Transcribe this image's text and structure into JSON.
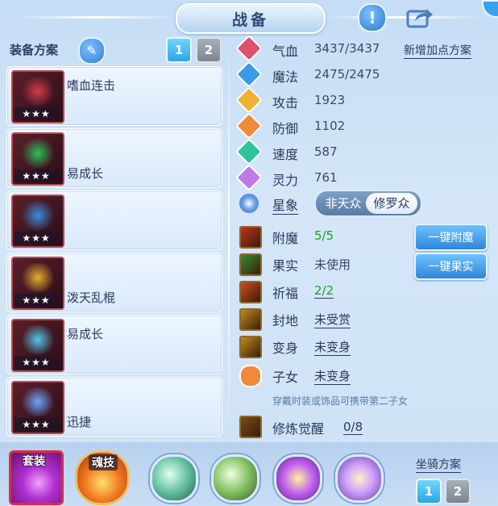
{
  "header": {
    "title": "战备",
    "info_icon": "info-icon",
    "share_icon": "share-icon"
  },
  "left": {
    "scheme_label": "装备方案",
    "scheme_tabs": [
      "1",
      "2"
    ],
    "active_scheme": "1",
    "skills": [
      {
        "name": "嗜血连击",
        "stars": "★★★",
        "glow": "#d23b4a"
      },
      {
        "name": "易成长",
        "stars": "★★★",
        "glow": "#2fbf5a"
      },
      {
        "name": "",
        "stars": "★★★",
        "glow": "#3a8be0"
      },
      {
        "name": "泼天乱棍",
        "stars": "★★★",
        "glow": "#e8b030"
      },
      {
        "name": "易成长",
        "stars": "★★★",
        "glow": "#4fc8e8"
      },
      {
        "name": "迅捷",
        "stars": "★★★",
        "glow": "#6aa8ff"
      }
    ]
  },
  "stats": [
    {
      "label": "气血",
      "value": "3437/3437",
      "color": "#e0506a",
      "icon": "heart-icon"
    },
    {
      "label": "魔法",
      "value": "2475/2475",
      "color": "#3a9be8",
      "icon": "mana-icon"
    },
    {
      "label": "攻击",
      "value": "1923",
      "color": "#f0b030",
      "icon": "sword-icon"
    },
    {
      "label": "防御",
      "value": "1102",
      "color": "#f08a3a",
      "icon": "armor-icon"
    },
    {
      "label": "速度",
      "value": "587",
      "color": "#2cc49a",
      "icon": "lightning-icon"
    },
    {
      "label": "灵力",
      "value": "761",
      "color": "#c07ae8",
      "icon": "spirit-icon"
    }
  ],
  "add_points_link": "新增加点方案",
  "star_sign": {
    "label": "星象",
    "options": [
      "非天众",
      "修罗众"
    ],
    "selected": "修罗众"
  },
  "attrs": [
    {
      "label": "附魔",
      "value": "5/5",
      "green": true,
      "underline": false,
      "icon": "enchant-icon"
    },
    {
      "label": "果实",
      "value": "未使用",
      "green": false,
      "underline": false,
      "icon": "fruit-icon"
    },
    {
      "label": "祈福",
      "value": "2/2",
      "green": true,
      "underline": true,
      "icon": "pray-icon"
    },
    {
      "label": "封地",
      "value": "未受赏",
      "green": false,
      "underline": true,
      "icon": "territory-icon"
    },
    {
      "label": "变身",
      "value": "未变身",
      "green": false,
      "underline": true,
      "icon": "transform-icon"
    },
    {
      "label": "子女",
      "value": "未变身",
      "green": false,
      "underline": true,
      "icon": "child-icon"
    }
  ],
  "buttons": {
    "enchant_all": "一键附魔",
    "fruit_all": "一键果实"
  },
  "child_hint": "穿戴时装或饰品可携带第二子女",
  "awaken": {
    "label": "修炼觉醒",
    "value": "0/8"
  },
  "bottom": {
    "suit_label": "套装",
    "soul_label": "魂技",
    "mount_label": "坐骑方案",
    "mount_tabs": [
      "1",
      "2"
    ]
  }
}
